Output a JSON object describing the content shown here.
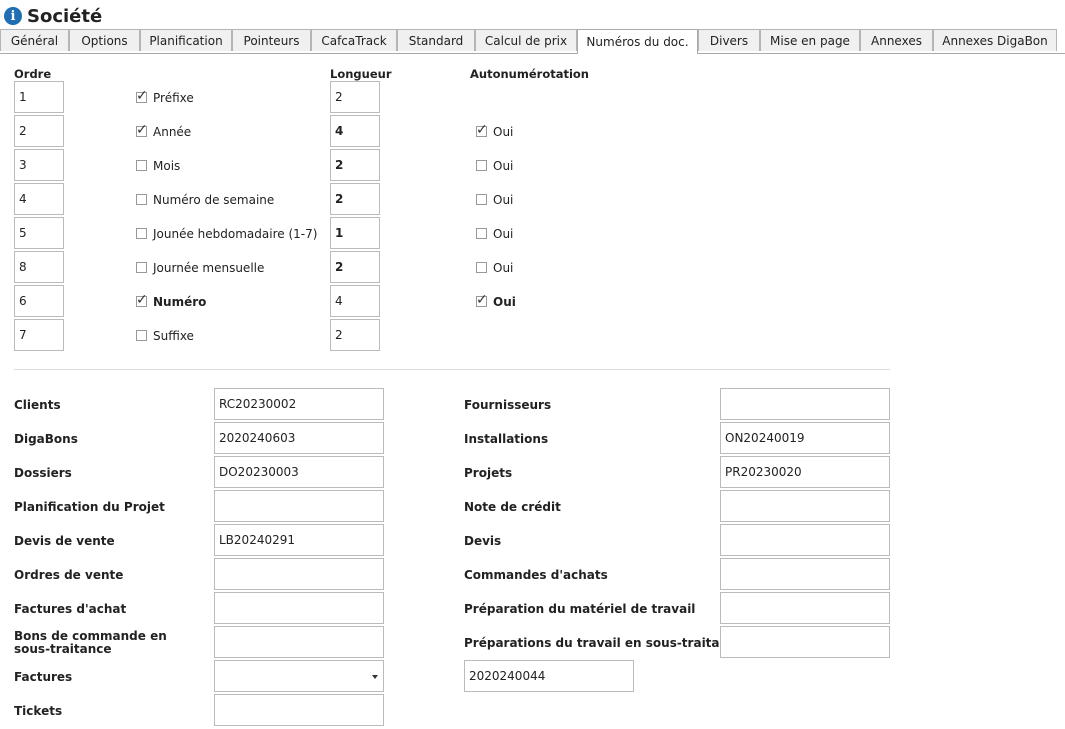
{
  "page": {
    "title": "Société"
  },
  "tabs": [
    {
      "label": "Général"
    },
    {
      "label": "Options"
    },
    {
      "label": "Planification"
    },
    {
      "label": "Pointeurs"
    },
    {
      "label": "CafcaTrack"
    },
    {
      "label": "Standard"
    },
    {
      "label": "Calcul de prix"
    },
    {
      "label": "Numéros du doc."
    },
    {
      "label": "Divers"
    },
    {
      "label": "Mise en page"
    },
    {
      "label": "Annexes"
    },
    {
      "label": "Annexes DigaBon"
    }
  ],
  "active_tab": "Numéros du doc.",
  "numbering": {
    "headers": {
      "order": "Ordre",
      "length": "Longueur",
      "auto": "Autonumérotation"
    },
    "rows": [
      {
        "order": "1",
        "label": "Préfixe",
        "checked": true,
        "length": "2",
        "auto": null
      },
      {
        "order": "2",
        "label": "Année",
        "checked": true,
        "length": "4",
        "auto": "Oui",
        "auto_checked": true
      },
      {
        "order": "3",
        "label": "Mois",
        "checked": false,
        "length": "2",
        "auto": "Oui",
        "auto_checked": false
      },
      {
        "order": "4",
        "label": "Numéro de semaine",
        "checked": false,
        "length": "2",
        "auto": "Oui",
        "auto_checked": false
      },
      {
        "order": "5",
        "label": "Jounée hebdomadaire (1-7)",
        "checked": false,
        "length": "1",
        "auto": "Oui",
        "auto_checked": false
      },
      {
        "order": "8",
        "label": "Journée mensuelle",
        "checked": false,
        "length": "2",
        "auto": "Oui",
        "auto_checked": false
      },
      {
        "order": "6",
        "label": "Numéro",
        "checked": true,
        "length": "4",
        "auto": "Oui",
        "auto_checked": true
      },
      {
        "order": "7",
        "label": "Suffixe",
        "checked": false,
        "length": "2",
        "auto": null
      }
    ]
  },
  "documents": {
    "left": [
      {
        "label": "Clients",
        "value": "RC20230002"
      },
      {
        "label": "DigaBons",
        "value": "2020240603"
      },
      {
        "label": "Dossiers",
        "value": "DO20230003"
      },
      {
        "label": "Planification du Projet",
        "value": ""
      },
      {
        "label": "Devis de vente",
        "value": "LB20240291"
      },
      {
        "label": "Ordres de vente",
        "value": ""
      },
      {
        "label": "Factures d'achat",
        "value": ""
      },
      {
        "label": "Bons de commande en sous-traitance",
        "value": ""
      },
      {
        "label": "Factures",
        "value": ""
      },
      {
        "label": "Tickets",
        "value": ""
      }
    ],
    "right": [
      {
        "label": "Fournisseurs",
        "value": ""
      },
      {
        "label": "Installations",
        "value": "ON20240019"
      },
      {
        "label": "Projets",
        "value": "PR20230020"
      },
      {
        "label": "Note de crédit",
        "value": ""
      },
      {
        "label": "Devis",
        "value": ""
      },
      {
        "label": "Commandes d'achats",
        "value": ""
      },
      {
        "label": "Préparation du matériel de travail",
        "value": ""
      },
      {
        "label": "Préparations du travail en sous-traitance",
        "value": ""
      }
    ],
    "extra_value": "2020240044"
  }
}
